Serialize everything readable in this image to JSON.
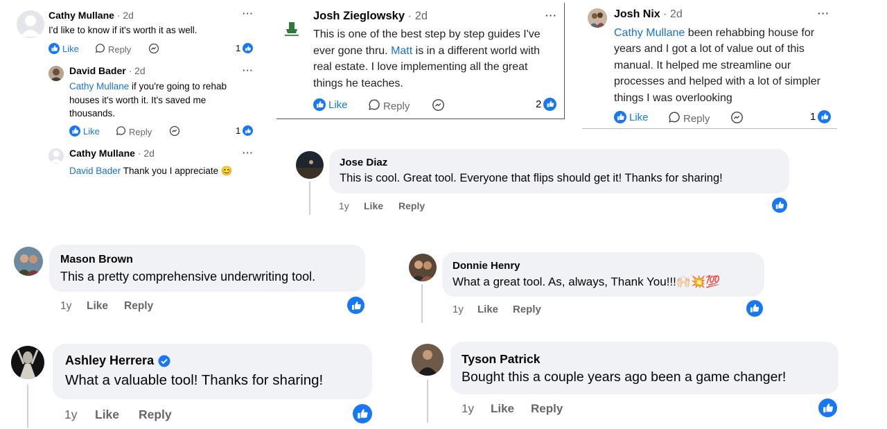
{
  "thread1": {
    "top": {
      "name": "Cathy Mullane",
      "time": "· 2d",
      "text": "I'd like to know if it's worth it as well.",
      "like": "Like",
      "reply": "Reply",
      "count": "1",
      "more": "···"
    },
    "reply1": {
      "name": "David Bader",
      "time": "· 2d",
      "mention": "Cathy Mullane",
      "text": " if you're going to rehab houses it's worth it. It's saved me thousands.",
      "like": "Like",
      "reply": "Reply",
      "count": "1",
      "more": "···"
    },
    "reply2": {
      "name": "Cathy Mullane",
      "time": "· 2d",
      "mention": "David Bader",
      "text": " Thank you I appreciate 😊",
      "more": "···"
    }
  },
  "josh_z": {
    "name": "Josh Zieglowsky",
    "time": "· 2d",
    "text_a": "This is one of the best step by step guides I've ever gone thru. ",
    "mention": "Matt",
    "text_b": " is in a different world with real estate. I love implementing all the great things he teaches.",
    "like": "Like",
    "reply": "Reply",
    "count": "2",
    "more": "···"
  },
  "josh_n": {
    "name": "Josh Nix",
    "time": "· 2d",
    "mention": "Cathy Mullane",
    "text": " been rehabbing house for years and I got a lot of value out of this manual. It helped me streamline our processes and helped with a lot of simpler things I was overlooking",
    "like": "Like",
    "reply": "Reply",
    "count": "1",
    "more": "···"
  },
  "comments": [
    {
      "name": "Jose Diaz",
      "text": "This is cool. Great tool. Everyone that flips should get it! Thanks for sharing!",
      "age": "1y",
      "like": "Like",
      "reply": "Reply"
    },
    {
      "name": "Mason Brown",
      "text": "This a pretty comprehensive underwriting tool.",
      "age": "1y",
      "like": "Like",
      "reply": "Reply"
    },
    {
      "name": "Donnie Henry",
      "text": "What a great tool. As, always, Thank You!!!🙌🏻💥💯",
      "age": "1y",
      "like": "Like",
      "reply": "Reply"
    },
    {
      "name": "Ashley Herrera",
      "text": "What a valuable tool! Thanks for sharing!",
      "age": "1y",
      "like": "Like",
      "reply": "Reply"
    },
    {
      "name": "Tyson Patrick",
      "text": "Bought this a couple years ago been a game changer!",
      "age": "1y",
      "like": "Like",
      "reply": "Reply"
    }
  ],
  "colors": {
    "accent": "#1877f2",
    "mention": "#1a6fd6",
    "bubble": "#f0f2f5",
    "meta": "#65676b"
  }
}
